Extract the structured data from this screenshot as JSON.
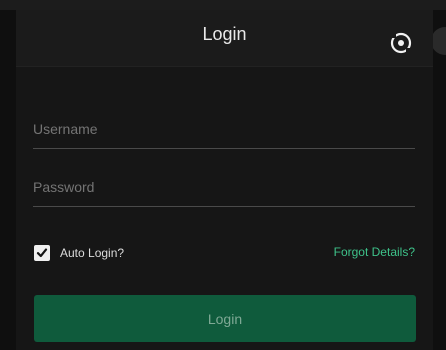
{
  "dialog": {
    "title": "Login",
    "close_icon": "close-icon"
  },
  "form": {
    "username_placeholder": "Username",
    "password_placeholder": "Password",
    "auto_login_label": "Auto Login?",
    "auto_login_checked": true,
    "forgot_label": "Forgot Details?",
    "login_label": "Login"
  },
  "colors": {
    "accent": "#3ec28a",
    "button_bg": "#0f5b3c",
    "panel_bg": "#161616"
  }
}
